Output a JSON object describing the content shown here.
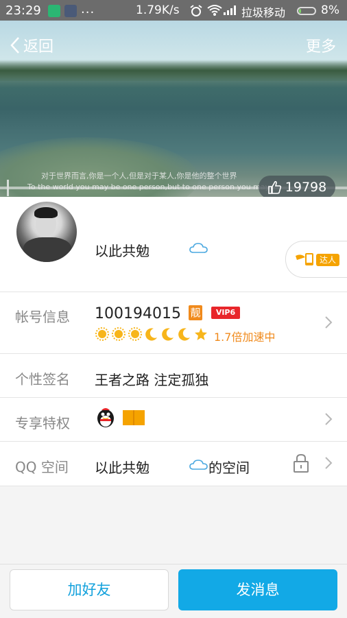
{
  "status_bar": {
    "time": "23:29",
    "dots": "...",
    "network_speed": "1.79K/s",
    "carrier": "拉圾移动",
    "battery": "8%"
  },
  "header": {
    "back_label": "返回",
    "more_label": "更多",
    "photo_caption_cn": "对于世界而言,你是一个人,但是对于某人,你是他的整个世界",
    "photo_caption_en": "To the world you may be one person,but to one person you may",
    "like_count": "19798"
  },
  "profile": {
    "nickname": "以此共勉",
    "daren_tag": "达人"
  },
  "rows": {
    "account": {
      "label": "帐号信息",
      "number": "100194015",
      "liang_badge": "靓",
      "vip_badge": "VIP6",
      "speed_text": "1.7倍加速中",
      "level_icons": [
        "sun",
        "sun",
        "sun",
        "moon",
        "moon",
        "moon",
        "star"
      ]
    },
    "signature": {
      "label": "个性签名",
      "text": "王者之路 注定孤独"
    },
    "privileges": {
      "label": "专享特权"
    },
    "qzone": {
      "label": "QQ 空间",
      "name": "以此共勉",
      "suffix": "的空间"
    }
  },
  "buttons": {
    "add_friend": "加好友",
    "send_message": "发消息"
  },
  "colors": {
    "accent": "#12a9e6",
    "vip_red": "#e8262a",
    "orange": "#f08a1c"
  }
}
